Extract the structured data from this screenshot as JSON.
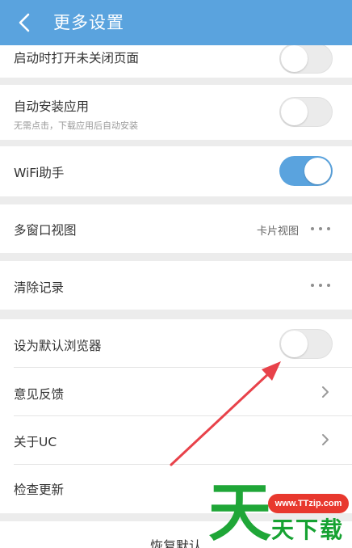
{
  "header": {
    "title": "更多设置",
    "background": "#5aa3de"
  },
  "items": {
    "open_unclosed": {
      "label": "启动时打开未关闭页面",
      "toggle": "off"
    },
    "auto_install": {
      "label": "自动安装应用",
      "sublabel": "无需点击，下载应用后自动安装",
      "toggle": "off"
    },
    "wifi_helper": {
      "label": "WiFi助手",
      "toggle": "on"
    },
    "multi_window": {
      "label": "多窗口视图",
      "value": "卡片视图"
    },
    "clear_records": {
      "label": "清除记录"
    },
    "default_browser": {
      "label": "设为默认浏览器",
      "toggle": "off"
    },
    "feedback": {
      "label": "意见反馈"
    },
    "about": {
      "label": "关于UC"
    },
    "check_update": {
      "label": "检查更新"
    }
  },
  "footer": {
    "restore_label": "恢复默认"
  },
  "watermark": {
    "logo_char": "天",
    "url": "www.TTzip.com",
    "name": "天下载",
    "green": "#1fa637",
    "red": "#e8382e"
  },
  "annotation": {
    "arrow_color": "#e8424a"
  }
}
